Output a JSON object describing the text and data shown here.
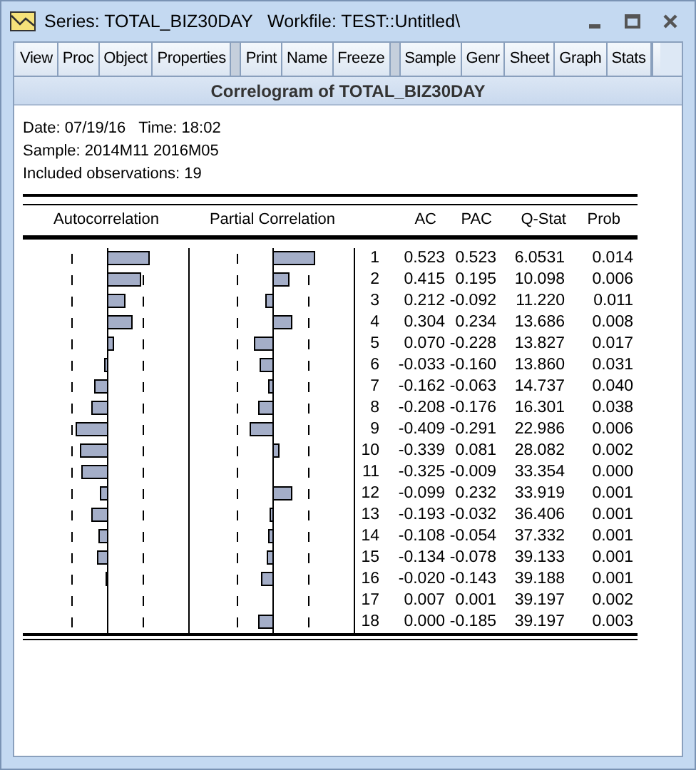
{
  "window": {
    "title": "Series: TOTAL_BIZ30DAY   Workfile: TEST::Untitled\\"
  },
  "toolbar": [
    {
      "label": "View",
      "kind": "button"
    },
    {
      "label": "Proc",
      "kind": "button"
    },
    {
      "label": "Object",
      "kind": "button"
    },
    {
      "label": "Properties",
      "kind": "button"
    },
    {
      "kind": "separator"
    },
    {
      "label": "Print",
      "kind": "button"
    },
    {
      "label": "Name",
      "kind": "button"
    },
    {
      "label": "Freeze",
      "kind": "button"
    },
    {
      "kind": "separator"
    },
    {
      "label": "Sample",
      "kind": "button"
    },
    {
      "label": "Genr",
      "kind": "button"
    },
    {
      "label": "Sheet",
      "kind": "button"
    },
    {
      "label": "Graph",
      "kind": "button"
    },
    {
      "label": "Stats",
      "kind": "button"
    },
    {
      "kind": "clipped"
    }
  ],
  "view_title": "Correlogram of TOTAL_BIZ30DAY",
  "info": [
    "Date: 07/19/16   Time: 18:02",
    "Sample: 2014M11 2016M05",
    "Included observations: 19"
  ],
  "columns": [
    "Autocorrelation",
    "Partial Correlation",
    "AC",
    "PAC",
    "Q-Stat",
    "Prob"
  ],
  "rows": [
    {
      "lag": "1",
      "ac": "0.523",
      "pac": "0.523",
      "q_stat": "6.0531",
      "prob": "0.014"
    },
    {
      "lag": "2",
      "ac": "0.415",
      "pac": "0.195",
      "q_stat": "10.098",
      "prob": "0.006"
    },
    {
      "lag": "3",
      "ac": "0.212",
      "pac": "-0.092",
      "q_stat": "11.220",
      "prob": "0.011"
    },
    {
      "lag": "4",
      "ac": "0.304",
      "pac": "0.234",
      "q_stat": "13.686",
      "prob": "0.008"
    },
    {
      "lag": "5",
      "ac": "0.070",
      "pac": "-0.228",
      "q_stat": "13.827",
      "prob": "0.017"
    },
    {
      "lag": "6",
      "ac": "-0.033",
      "pac": "-0.160",
      "q_stat": "13.860",
      "prob": "0.031"
    },
    {
      "lag": "7",
      "ac": "-0.162",
      "pac": "-0.063",
      "q_stat": "14.737",
      "prob": "0.040"
    },
    {
      "lag": "8",
      "ac": "-0.208",
      "pac": "-0.176",
      "q_stat": "16.301",
      "prob": "0.038"
    },
    {
      "lag": "9",
      "ac": "-0.409",
      "pac": "-0.291",
      "q_stat": "22.986",
      "prob": "0.006"
    },
    {
      "lag": "10",
      "ac": "-0.339",
      "pac": "0.081",
      "q_stat": "28.082",
      "prob": "0.002"
    },
    {
      "lag": "11",
      "ac": "-0.325",
      "pac": "-0.009",
      "q_stat": "33.354",
      "prob": "0.000"
    },
    {
      "lag": "12",
      "ac": "-0.099",
      "pac": "0.232",
      "q_stat": "33.919",
      "prob": "0.001"
    },
    {
      "lag": "13",
      "ac": "-0.193",
      "pac": "-0.032",
      "q_stat": "36.406",
      "prob": "0.001"
    },
    {
      "lag": "14",
      "ac": "-0.108",
      "pac": "-0.054",
      "q_stat": "37.332",
      "prob": "0.001"
    },
    {
      "lag": "15",
      "ac": "-0.134",
      "pac": "-0.078",
      "q_stat": "39.133",
      "prob": "0.001"
    },
    {
      "lag": "16",
      "ac": "-0.020",
      "pac": "-0.143",
      "q_stat": "39.188",
      "prob": "0.001"
    },
    {
      "lag": "17",
      "ac": "0.007",
      "pac": "0.001",
      "q_stat": "39.197",
      "prob": "0.002"
    },
    {
      "lag": "18",
      "ac": "0.000",
      "pac": "-0.185",
      "q_stat": "39.197",
      "prob": "0.003"
    }
  ]
}
